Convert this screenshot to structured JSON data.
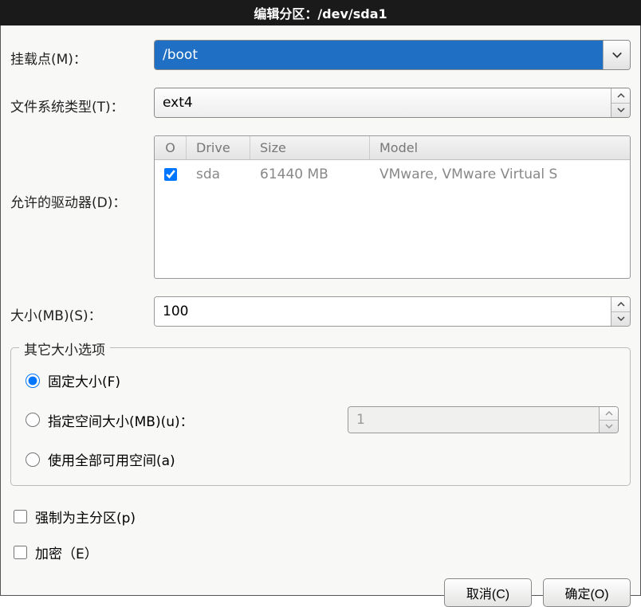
{
  "title": "编辑分区：/dev/sda1",
  "labels": {
    "mount_point": "挂载点(M)：",
    "fs_type": "文件系统类型(T)：",
    "allowed_drives": "允许的驱动器(D)：",
    "size_mb": "大小(MB)(S)：",
    "other_size_opts": "其它大小选项",
    "fixed_size": "固定大小(F)",
    "fill_up_to": "指定空间大小(MB)(u)：",
    "fill_all": "使用全部可用空间(a)",
    "force_primary": "强制为主分区(p)",
    "encrypt": "加密（E）"
  },
  "values": {
    "mount_point": "/boot",
    "fs_type": "ext4",
    "size_mb": "100",
    "fill_up_to_value": "1"
  },
  "drive_table": {
    "headers": {
      "check": "O",
      "drive": "Drive",
      "size": "Size",
      "model": "Model"
    },
    "rows": [
      {
        "checked": true,
        "drive": "sda",
        "size": "61440 MB",
        "model": "VMware, VMware Virtual S"
      }
    ]
  },
  "size_option_selected": "fixed",
  "force_primary_checked": false,
  "encrypt_checked": false,
  "buttons": {
    "cancel": "取消(C)",
    "ok": "确定(O)"
  }
}
